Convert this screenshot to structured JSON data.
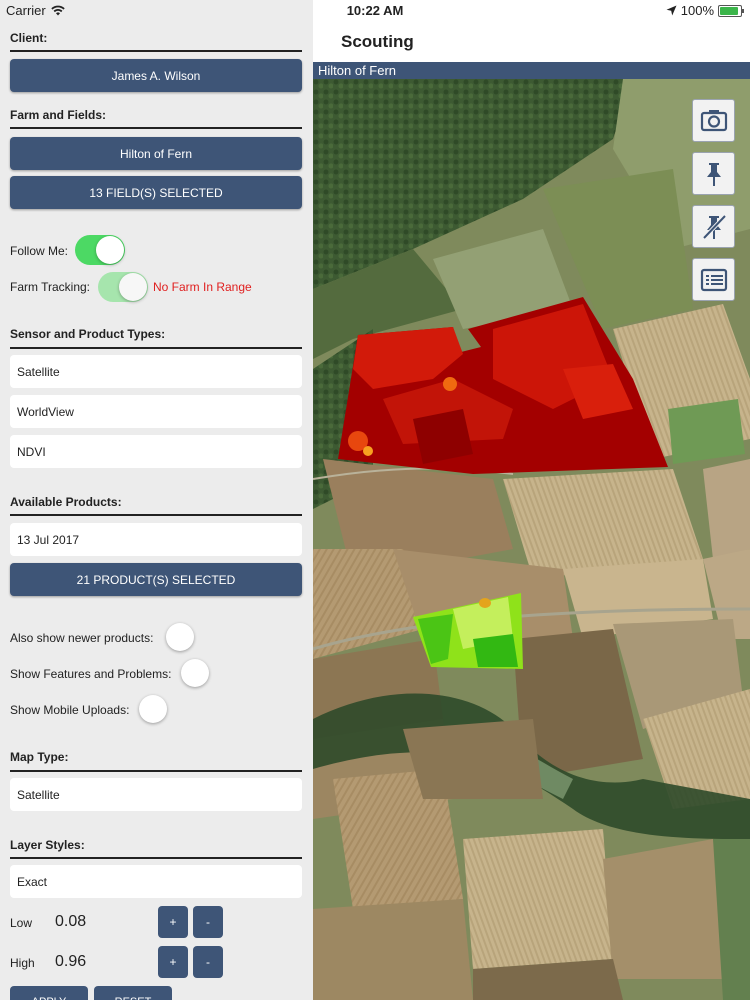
{
  "status_bar": {
    "carrier": "Carrier",
    "time": "10:22 AM",
    "battery": "100%"
  },
  "client": {
    "label": "Client:",
    "value": "James A. Wilson"
  },
  "farm_fields": {
    "label": "Farm and Fields:",
    "farm": "Hilton of Fern",
    "fields": "13 FIELD(S) SELECTED"
  },
  "tracking": {
    "follow_me_label": "Follow Me:",
    "farm_tracking_label": "Farm Tracking:",
    "farm_tracking_status": "No Farm In Range"
  },
  "sensor": {
    "label": "Sensor and Product Types:",
    "sensor": "Satellite",
    "product": "WorldView",
    "index": "NDVI"
  },
  "products": {
    "label": "Available Products:",
    "date": "13 Jul 2017",
    "selected": "21 PRODUCT(S) SELECTED",
    "newer_label": "Also show newer products:",
    "features_label": "Show Features and Problems:",
    "uploads_label": "Show Mobile Uploads:"
  },
  "map_type": {
    "label": "Map Type:",
    "value": "Satellite"
  },
  "layer_styles": {
    "label": "Layer Styles:",
    "value": "Exact",
    "low_label": "Low",
    "low_value": "0.08",
    "high_label": "High",
    "high_value": "0.96",
    "plus": "+",
    "minus": "-",
    "apply": "APPLY",
    "reset": "RESET"
  },
  "nav": {
    "title": "Scouting",
    "farm_strip": "Hilton of Fern"
  },
  "map_tools": [
    "camera-icon",
    "pin-icon",
    "pin-off-icon",
    "list-icon"
  ],
  "colors": {
    "accent": "#3e5577",
    "toggle_on": "#4cd964",
    "warning": "#e02020"
  }
}
